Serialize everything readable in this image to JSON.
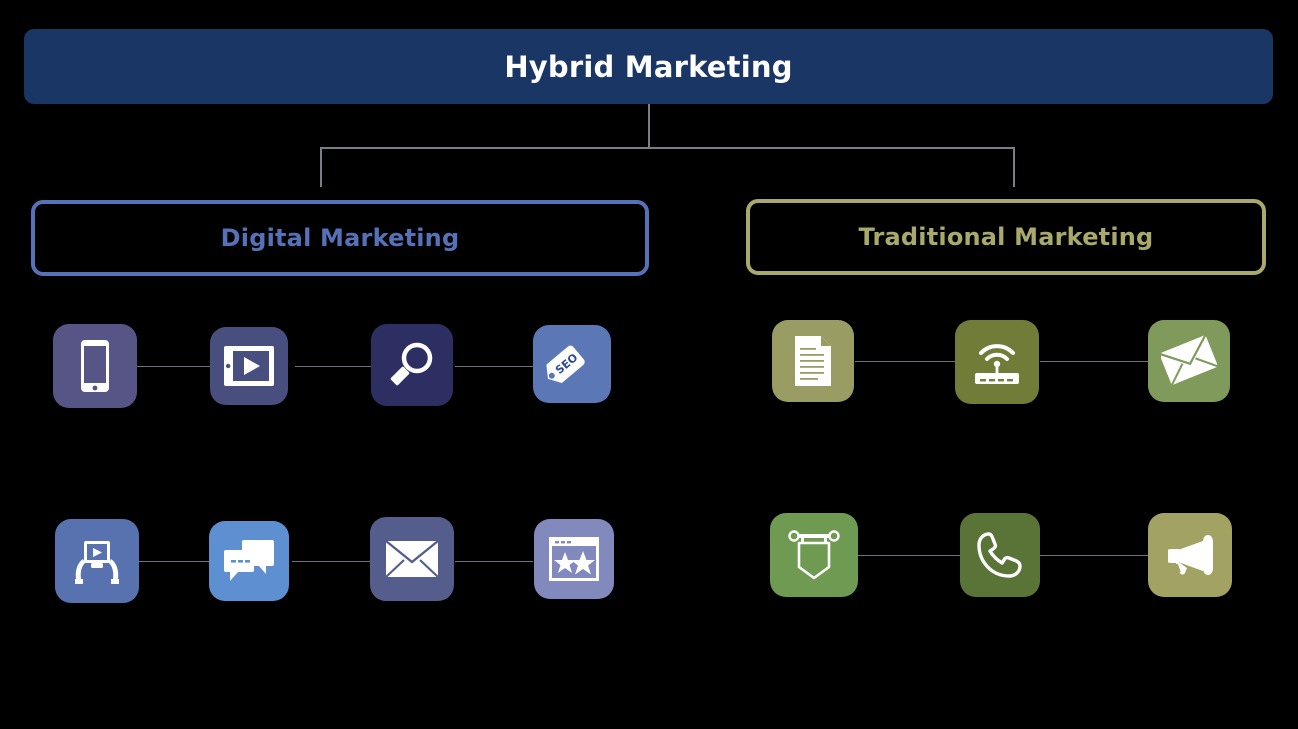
{
  "page": {
    "background": "#000000",
    "connector_color": "#7a7f87",
    "link_color": "#6f727a",
    "title": "Hybrid Marketing"
  },
  "root": {
    "label": "Hybrid Marketing",
    "fill": "#1a3664",
    "text_color": "#ffffff"
  },
  "branches": [
    {
      "id": "digital",
      "label": "Digital Marketing",
      "border_color": "#5571b8",
      "text_color": "#5571b8"
    },
    {
      "id": "traditional",
      "label": "Traditional Marketing",
      "border_color": "#a8a96a",
      "text_color": "#a8a96a"
    }
  ],
  "digital_icons": {
    "row1": [
      {
        "name": "mobile-phone-icon",
        "label": "Mobile",
        "color": "#565586"
      },
      {
        "name": "video-tablet-icon",
        "label": "Video",
        "color": "#484f7e"
      },
      {
        "name": "magnifying-glass-icon",
        "label": "Search",
        "color": "#2d2f63"
      },
      {
        "name": "seo-tag-icon",
        "label": "SEO",
        "color": "#5c77b5",
        "tag_text": "SEO"
      }
    ],
    "row2": [
      {
        "name": "hands-holding-tablet-video-icon",
        "label": "Video Marketing",
        "color": "#5872b0"
      },
      {
        "name": "chat-bubbles-icon",
        "label": "Social Chat",
        "color": "#5e8fd0"
      },
      {
        "name": "email-envelope-icon",
        "label": "Email",
        "color": "#555d8c"
      },
      {
        "name": "browser-reviews-stars-icon",
        "label": "Reviews",
        "color": "#8189bd"
      }
    ]
  },
  "traditional_icons": {
    "row1": [
      {
        "name": "newspaper-document-icon",
        "label": "Print",
        "color": "#9a9d63"
      },
      {
        "name": "wifi-router-broadcast-icon",
        "label": "Broadcast",
        "color": "#707c37"
      },
      {
        "name": "mail-envelope-tilted-icon",
        "label": "Direct Mail",
        "color": "#7f9a5b"
      }
    ],
    "row2": [
      {
        "name": "hanging-banner-icon",
        "label": "Signage",
        "color": "#6e9a52"
      },
      {
        "name": "telephone-handset-icon",
        "label": "Telemarketing",
        "color": "#5a7438"
      },
      {
        "name": "megaphone-icon",
        "label": "Promotion",
        "color": "#a2a263"
      }
    ]
  }
}
